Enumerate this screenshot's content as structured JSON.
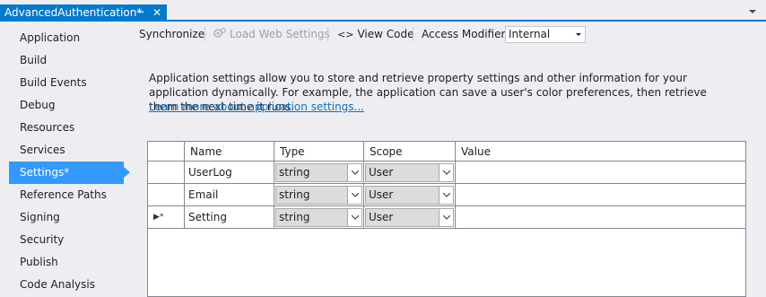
{
  "tab": {
    "title": "AdvancedAuthentication*",
    "pin_glyph": "⭲",
    "close_glyph": "✕"
  },
  "nav": {
    "items": [
      {
        "label": "Application",
        "active": false
      },
      {
        "label": "Build",
        "active": false
      },
      {
        "label": "Build Events",
        "active": false
      },
      {
        "label": "Debug",
        "active": false
      },
      {
        "label": "Resources",
        "active": false
      },
      {
        "label": "Services",
        "active": false
      },
      {
        "label": "Settings*",
        "active": true
      },
      {
        "label": "Reference Paths",
        "active": false
      },
      {
        "label": "Signing",
        "active": false
      },
      {
        "label": "Security",
        "active": false
      },
      {
        "label": "Publish",
        "active": false
      },
      {
        "label": "Code Analysis",
        "active": false
      }
    ]
  },
  "toolbar": {
    "synchronize": "Synchronize",
    "load_web_settings": "Load Web Settings",
    "view_code": "View Code",
    "view_code_glyph": "<>",
    "access_modifier_label": "Access Modifier:",
    "access_modifier_value": "Internal"
  },
  "description": {
    "text": "Application settings allow you to store and retrieve property settings and other information for your application dynamically. For example, the application can save a user's color preferences, then retrieve them the next time it runs.",
    "link": "Learn more about application settings..."
  },
  "grid": {
    "columns": [
      "Name",
      "Type",
      "Scope",
      "Value"
    ],
    "rows": [
      {
        "marker": "",
        "name": "UserLog",
        "type": "string",
        "scope": "User",
        "value": ""
      },
      {
        "marker": "",
        "name": "Email",
        "type": "string",
        "scope": "User",
        "value": ""
      },
      {
        "marker": "▶*",
        "name": "Setting",
        "type": "string",
        "scope": "User",
        "value": ""
      }
    ]
  },
  "colors": {
    "accent": "#007acc",
    "selection": "#3399ff",
    "link": "#0e70c0",
    "background": "#eeeef2"
  }
}
